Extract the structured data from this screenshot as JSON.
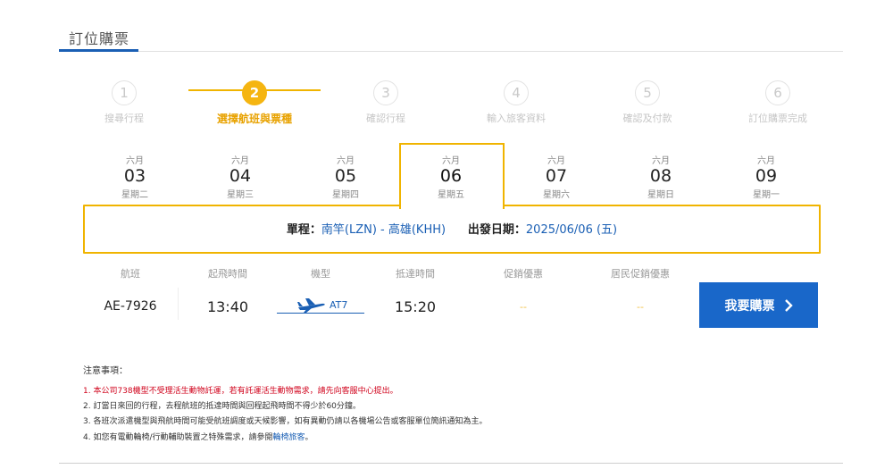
{
  "page": {
    "title": "訂位購票"
  },
  "stepper": [
    {
      "num": "1",
      "label": "搜尋行程"
    },
    {
      "num": "2",
      "label": "選擇航班與票種"
    },
    {
      "num": "3",
      "label": "確認行程"
    },
    {
      "num": "4",
      "label": "輸入旅客資料"
    },
    {
      "num": "5",
      "label": "確認及付款"
    },
    {
      "num": "6",
      "label": "訂位購票完成"
    }
  ],
  "dates": [
    {
      "month": "六月",
      "day": "03",
      "weekday": "星期二"
    },
    {
      "month": "六月",
      "day": "04",
      "weekday": "星期三"
    },
    {
      "month": "六月",
      "day": "05",
      "weekday": "星期四"
    },
    {
      "month": "六月",
      "day": "06",
      "weekday": "星期五"
    },
    {
      "month": "六月",
      "day": "07",
      "weekday": "星期六"
    },
    {
      "month": "六月",
      "day": "08",
      "weekday": "星期日"
    },
    {
      "month": "六月",
      "day": "09",
      "weekday": "星期一"
    }
  ],
  "selected_date_index": 3,
  "route": {
    "prefix": "單程：",
    "route": "南竿(LZN) - 高雄(KHH)",
    "date_label": "出發日期：",
    "date": "2025/06/06 (五)"
  },
  "table": {
    "headers": [
      "航班",
      "起飛時間",
      "機型",
      "抵達時間",
      "促銷優惠",
      "居民促銷優惠"
    ],
    "row": {
      "flight": "AE-7926",
      "depart": "13:40",
      "aircraft": "AT7",
      "arrive": "15:20",
      "promo": "--",
      "resident_promo": "--"
    }
  },
  "buy_button": {
    "label": "我要購票",
    "icon": "chevron-right-icon"
  },
  "notes": {
    "title": "注意事項：",
    "items": [
      "1. 本公司738機型不受理活生動物託運，若有託運活生動物需求，請先向客服中心提出。",
      "2. 訂當日來回的行程，去程航班的抵達時間與回程起飛時間不得少於60分鐘。",
      "3. 各班次派遣機型與飛航時間可能受航班調度或天候影響，如有異動仍請以各機場公告或客服單位簡訊通知為主。"
    ],
    "item4_prefix": "4. 如您有電動輪椅/行動輔助裝置之特殊需求，請參閱",
    "item4_link": "輪椅旅客",
    "item4_suffix": "。"
  },
  "colors": {
    "accent": "#f0b400",
    "brand_blue": "#1967c9",
    "warning_red": "#d0021b"
  }
}
